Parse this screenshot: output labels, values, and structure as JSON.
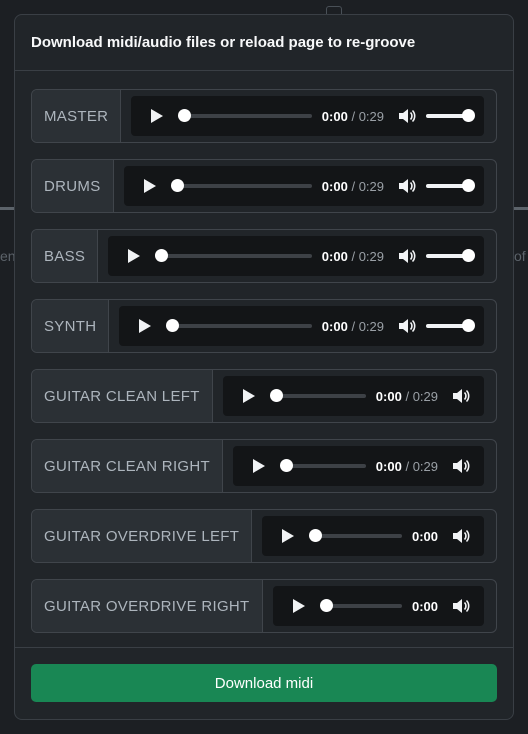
{
  "modal": {
    "title": "Download midi/audio files or reload page to re-groove",
    "download_label": "Download midi"
  },
  "background": {
    "left_text": "en",
    "right_text": "of"
  },
  "tracks": [
    {
      "label": "MASTER",
      "current": "0:00",
      "separator": "/",
      "duration": "0:29",
      "volume": 1.0
    },
    {
      "label": "DRUMS",
      "current": "0:00",
      "separator": "/",
      "duration": "0:29",
      "volume": 1.0
    },
    {
      "label": "BASS",
      "current": "0:00",
      "separator": "/",
      "duration": "0:29",
      "volume": 1.0
    },
    {
      "label": "SYNTH",
      "current": "0:00",
      "separator": "/",
      "duration": "0:29",
      "volume": 1.0
    },
    {
      "label": "GUITAR CLEAN LEFT",
      "current": "0:00",
      "separator": "/",
      "duration": "0:29"
    },
    {
      "label": "GUITAR CLEAN RIGHT",
      "current": "0:00",
      "separator": "/",
      "duration": "0:29"
    },
    {
      "label": "GUITAR OVERDRIVE LEFT",
      "current": "0:00"
    },
    {
      "label": "GUITAR OVERDRIVE RIGHT",
      "current": "0:00"
    }
  ],
  "colors": {
    "accent": "#198754",
    "background": "#212529"
  }
}
